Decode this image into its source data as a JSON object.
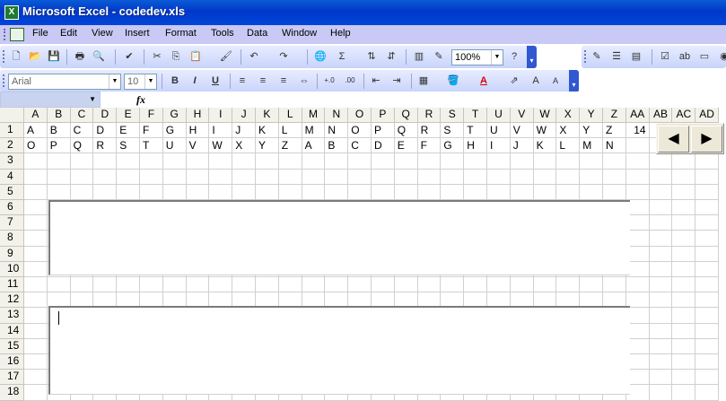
{
  "window": {
    "title": "Microsoft Excel - codedev.xls"
  },
  "menu": [
    "File",
    "Edit",
    "View",
    "Insert",
    "Format",
    "Tools",
    "Data",
    "Window",
    "Help"
  ],
  "toolbar": {
    "zoom": "100%",
    "font": "Arial",
    "font_size": "10",
    "fx_label": "fx"
  },
  "columns": [
    "A",
    "B",
    "C",
    "D",
    "E",
    "F",
    "G",
    "H",
    "I",
    "J",
    "K",
    "L",
    "M",
    "N",
    "O",
    "P",
    "Q",
    "R",
    "S",
    "T",
    "U",
    "V",
    "W",
    "X",
    "Y",
    "Z",
    "AA",
    "AB",
    "AC",
    "AD"
  ],
  "rows": [
    "1",
    "2",
    "3",
    "4",
    "5",
    "6",
    "7",
    "8",
    "9",
    "10",
    "11",
    "12",
    "13",
    "14",
    "15",
    "16",
    "17",
    "18"
  ],
  "cells": {
    "row1": [
      "A",
      "B",
      "C",
      "D",
      "E",
      "F",
      "G",
      "H",
      "I",
      "J",
      "K",
      "L",
      "M",
      "N",
      "O",
      "P",
      "Q",
      "R",
      "S",
      "T",
      "U",
      "V",
      "W",
      "X",
      "Y",
      "Z",
      "14"
    ],
    "row2": [
      "O",
      "P",
      "Q",
      "R",
      "S",
      "T",
      "U",
      "V",
      "W",
      "X",
      "Y",
      "Z",
      "A",
      "B",
      "C",
      "D",
      "E",
      "F",
      "G",
      "H",
      "I",
      "J",
      "K",
      "L",
      "M",
      "N"
    ]
  },
  "scroll_buttons": {
    "left": "◀",
    "right": "▶"
  }
}
